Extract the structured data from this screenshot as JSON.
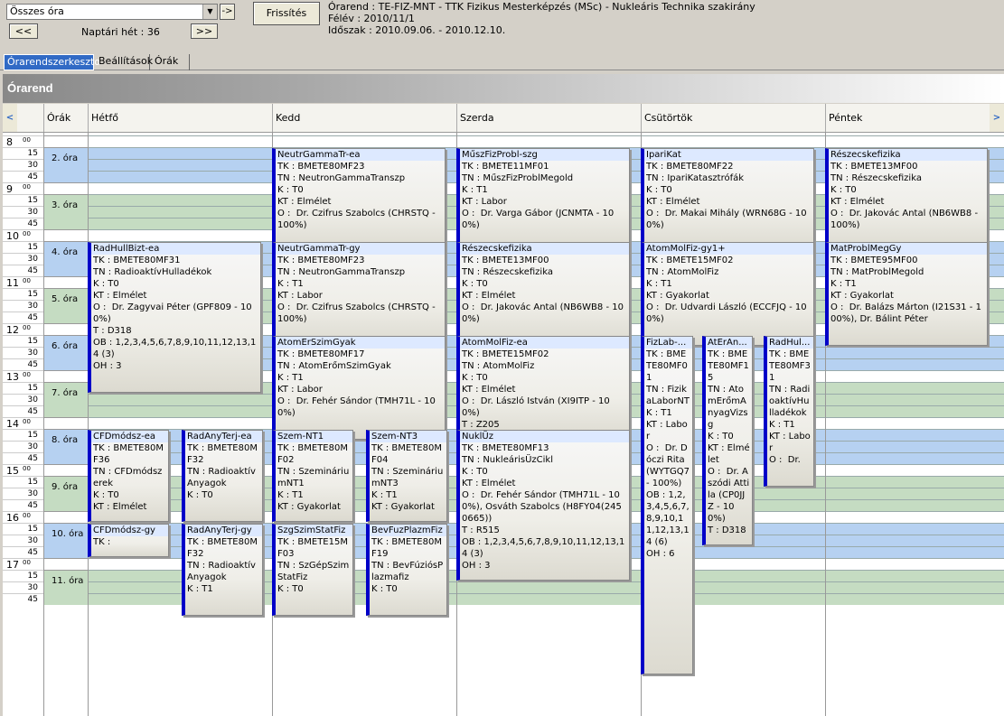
{
  "toolbar": {
    "filter_value": "Összes óra",
    "go_label": "->",
    "refresh_label": "Frissítés",
    "prev_label": "<<",
    "next_label": ">>",
    "week_label": "Naptári hét : 36"
  },
  "info": {
    "line1": "Órarend : TE-FIZ-MNT - TTK Fizikus Mesterképzés (MSc) - Nukleáris Technika szakirány",
    "line2": "Félév : 2010/11/1",
    "line3": "Időszak : 2010.09.06. - 2010.12.10."
  },
  "tabs": [
    "Órarendszerkeszto",
    "Beállítások",
    "Órák"
  ],
  "banner": "Órarend",
  "columns": {
    "left_scroll": "<",
    "right_scroll": ">",
    "orak": "Órák",
    "days": [
      "Hétfő",
      "Kedd",
      "Szerda",
      "Csütörtök",
      "Péntek"
    ]
  },
  "hours": [
    "8",
    "9",
    "10",
    "11",
    "12",
    "13",
    "14",
    "15",
    "16",
    "17"
  ],
  "minute_sup": "00",
  "quarters": [
    "15",
    "30",
    "45"
  ],
  "periods": [
    "2. óra",
    "3. óra",
    "4. óra",
    "5. óra",
    "6. óra",
    "7. óra",
    "8. óra",
    "9. óra",
    "10. óra",
    "11. óra"
  ],
  "events": [
    {
      "title": "NeutrGammaTr-ea",
      "lines": [
        "TK : BMETE80MF23",
        "TN : NeutronGammaTranszp",
        "K : T0",
        "KT : Elmélet",
        "O :  Dr. Czifrus Szabolcs (CHRSTQ - 100%)"
      ]
    },
    {
      "title": "MűszFizProbl-szg",
      "lines": [
        "TK : BMETE11MF01",
        "TN : MűszFizProblMegold",
        "K : T1",
        "KT : Labor",
        "O :  Dr. Varga Gábor (JCNMTA - 100%)"
      ]
    },
    {
      "title": "IpariKat",
      "lines": [
        "TK : BMETE80MF22",
        "TN : IpariKatasztrófák",
        "K : T0",
        "KT : Elmélet",
        "O :  Dr. Makai Mihály (WRN68G - 100%)"
      ]
    },
    {
      "title": "Részecskefizika",
      "lines": [
        "TK : BMETE13MF00",
        "TN : Részecskefizika",
        "K : T0",
        "KT : Elmélet",
        "O :  Dr. Jakovác Antal (NB6WB8 - 100%)"
      ]
    },
    {
      "title": "RadHullBizt-ea",
      "lines": [
        "TK : BMETE80MF31",
        "TN : RadioaktívHulladékok",
        "K : T0",
        "KT : Elmélet",
        "O :  Dr. Zagyvai Péter (GPF809 - 100%)",
        "T : D318",
        "OB : 1,2,3,4,5,6,7,8,9,10,11,12,13,14 (3)",
        "OH : 3"
      ]
    },
    {
      "title": "NeutrGammaTr-gy",
      "lines": [
        "TK : BMETE80MF23",
        "TN : NeutronGammaTranszp",
        "K : T1",
        "KT : Labor",
        "O :  Dr. Czifrus Szabolcs (CHRSTQ - 100%)"
      ]
    },
    {
      "title": "Részecskefizika",
      "lines": [
        "TK : BMETE13MF00",
        "TN : Részecskefizika",
        "K : T0",
        "KT : Elmélet",
        "O :  Dr. Jakovác Antal (NB6WB8 - 100%)"
      ]
    },
    {
      "title": "AtomMolFiz-gy1+",
      "lines": [
        "TK : BMETE15MF02",
        "TN : AtomMolFiz",
        "K : T1",
        "KT : Gyakorlat",
        "O :  Dr. Udvardi László (ECCFJQ - 100%)"
      ]
    },
    {
      "title": "MatProblMegGy",
      "lines": [
        "TK : BMETE95MF00",
        "TN : MatProblMegold",
        "K : T1",
        "KT : Gyakorlat",
        "O :  Dr. Balázs Márton (I21S31 - 100%), Dr. Bálint Péter"
      ]
    },
    {
      "title": "AtomErSzimGyak",
      "lines": [
        "TK : BMETE80MF17",
        "TN : AtomErőmSzimGyak",
        "K : T1",
        "KT : Labor",
        "O :  Dr. Fehér Sándor (TMH71L - 100%)"
      ]
    },
    {
      "title": "AtomMolFiz-ea",
      "lines": [
        "TK : BMETE15MF02",
        "TN : AtomMolFiz",
        "K : T0",
        "KT : Elmélet",
        "O :  Dr. László István (XI9ITP - 100%)",
        "T : Z205"
      ]
    },
    {
      "title": "FizLab-...",
      "lines": [
        "TK : BMETE80MF01",
        "TN : FizikaLaborNT",
        "K : T1",
        "KT : Labor",
        "O :  Dr. Dóczi Rita (WYTGQ7 - 100%)",
        "OB : 1,2,3,4,5,6,7,8,9,10,11,12,13,14 (6)",
        "OH : 6"
      ]
    },
    {
      "title": "AtErAn...",
      "lines": [
        "TK : BMETE80MF15",
        "TN : AtomErőmAnyagVizsg",
        "K : T0",
        "KT : Elmélet",
        "O :  Dr. Aszódi Attila (CP0JJZ - 100%)",
        "T : D318"
      ]
    },
    {
      "title": "RadHul...",
      "lines": [
        "TK : BMETE80MF31",
        "TN : RadioaktívHulladékok",
        "K : T1",
        "KT : Labor",
        "O :  Dr."
      ]
    },
    {
      "title": "CFDmódsz-ea",
      "lines": [
        "TK : BMETE80MF36",
        "TN : CFDmódszerek",
        "K : T0",
        "KT : Elmélet"
      ]
    },
    {
      "title": "RadAnyTerj-ea",
      "lines": [
        "TK : BMETE80MF32",
        "TN : RadioaktívAnyagok",
        "K : T0"
      ]
    },
    {
      "title": "Szem-NT1",
      "lines": [
        "TK : BMETE80MF02",
        "TN : SzemináriumNT1",
        "K : T1",
        "KT : Gyakorlat"
      ]
    },
    {
      "title": "Szem-NT3",
      "lines": [
        "TK : BMETE80MF04",
        "TN : SzemináriumNT3",
        "K : T1",
        "KT : Gyakorlat"
      ]
    },
    {
      "title": "NuklÜz",
      "lines": [
        "TK : BMETE80MF13",
        "TN : NukleárisÜzCikl",
        "K : T0",
        "KT : Elmélet",
        "O :  Dr. Fehér Sándor (TMH71L - 100%), Osváth Szabolcs (H8FY04(2450665))",
        "T : R515",
        "OB : 1,2,3,4,5,6,7,8,9,10,11,12,13,14 (3)",
        "OH : 3"
      ]
    },
    {
      "title": "CFDmódsz-gy",
      "lines": [
        "TK :"
      ]
    },
    {
      "title": "RadAnyTerj-gy",
      "lines": [
        "TK : BMETE80MF32",
        "TN : RadioaktívAnyagok",
        "K : T1"
      ]
    },
    {
      "title": "SzgSzimStatFiz",
      "lines": [
        "TK : BMETE15MF03",
        "TN : SzGépSzimStatFiz",
        "K : T0"
      ]
    },
    {
      "title": "BevFuzPlazmFiz",
      "lines": [
        "TK : BMETE80MF19",
        "TN : BevFúziósPlazmafiz",
        "K : T0"
      ]
    }
  ]
}
